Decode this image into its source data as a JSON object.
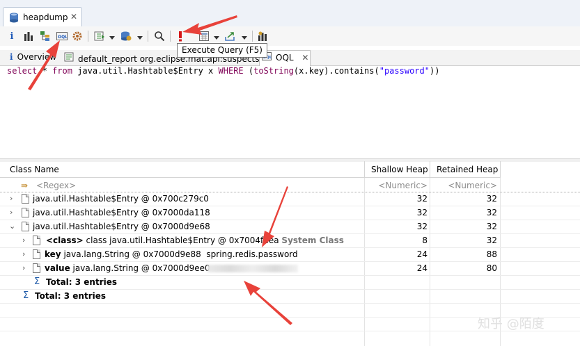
{
  "editor_tab": {
    "label": "heapdump",
    "close": "✕"
  },
  "tooltip": "Execute Query (F5)",
  "subtabs": [
    {
      "label": "Overview",
      "icon": "info-icon"
    },
    {
      "label": "default_report  org.eclipse.mat.api:suspects",
      "icon": "report-icon"
    },
    {
      "label": "OQL",
      "icon": "oql-icon",
      "close": "✕"
    }
  ],
  "query": {
    "select": "select",
    "star": "*",
    "from": "from",
    "class_name": "java.util.Hashtable$Entry x",
    "where": "WHERE",
    "open_paren": "(",
    "to_string": "toString",
    "call": "(x.key).contains(",
    "string_literal": "\"password\"",
    "close_parens": "))"
  },
  "table": {
    "columns": [
      "Class Name",
      "Shallow Heap",
      "Retained Heap"
    ],
    "regex_placeholder": "<Regex>",
    "numeric_placeholder": "<Numeric>",
    "rows": [
      {
        "name": "java.util.Hashtable$Entry @ 0x700c279c0",
        "shallow": "32",
        "retained": "32"
      },
      {
        "name": "java.util.Hashtable$Entry @ 0x7000da118",
        "shallow": "32",
        "retained": "32"
      },
      {
        "name": "java.util.Hashtable$Entry @ 0x7000d9e68",
        "shallow": "32",
        "retained": "32"
      }
    ],
    "children": [
      {
        "field": "<class>",
        "name": "class java.util.Hashtable$Entry @ 0x7004f2ea",
        "extra": "System Class",
        "shallow": "8",
        "retained": "32"
      },
      {
        "field": "key",
        "name": "java.lang.String @ 0x7000d9e88",
        "extra": "spring.redis.password",
        "shallow": "24",
        "retained": "88"
      },
      {
        "field": "value",
        "name": "java.lang.String @ 0x7000d9ee0",
        "extra": "",
        "shallow": "24",
        "retained": "80"
      }
    ],
    "inner_total": "Total: 3 entries",
    "outer_total": "Total: 3 entries"
  },
  "watermark": "知乎 @陌度",
  "colors": {
    "keyword": "#7f0055",
    "string": "#2a00ff",
    "annotation_arrow": "#e8423a",
    "execute_icon": "#d41616"
  }
}
